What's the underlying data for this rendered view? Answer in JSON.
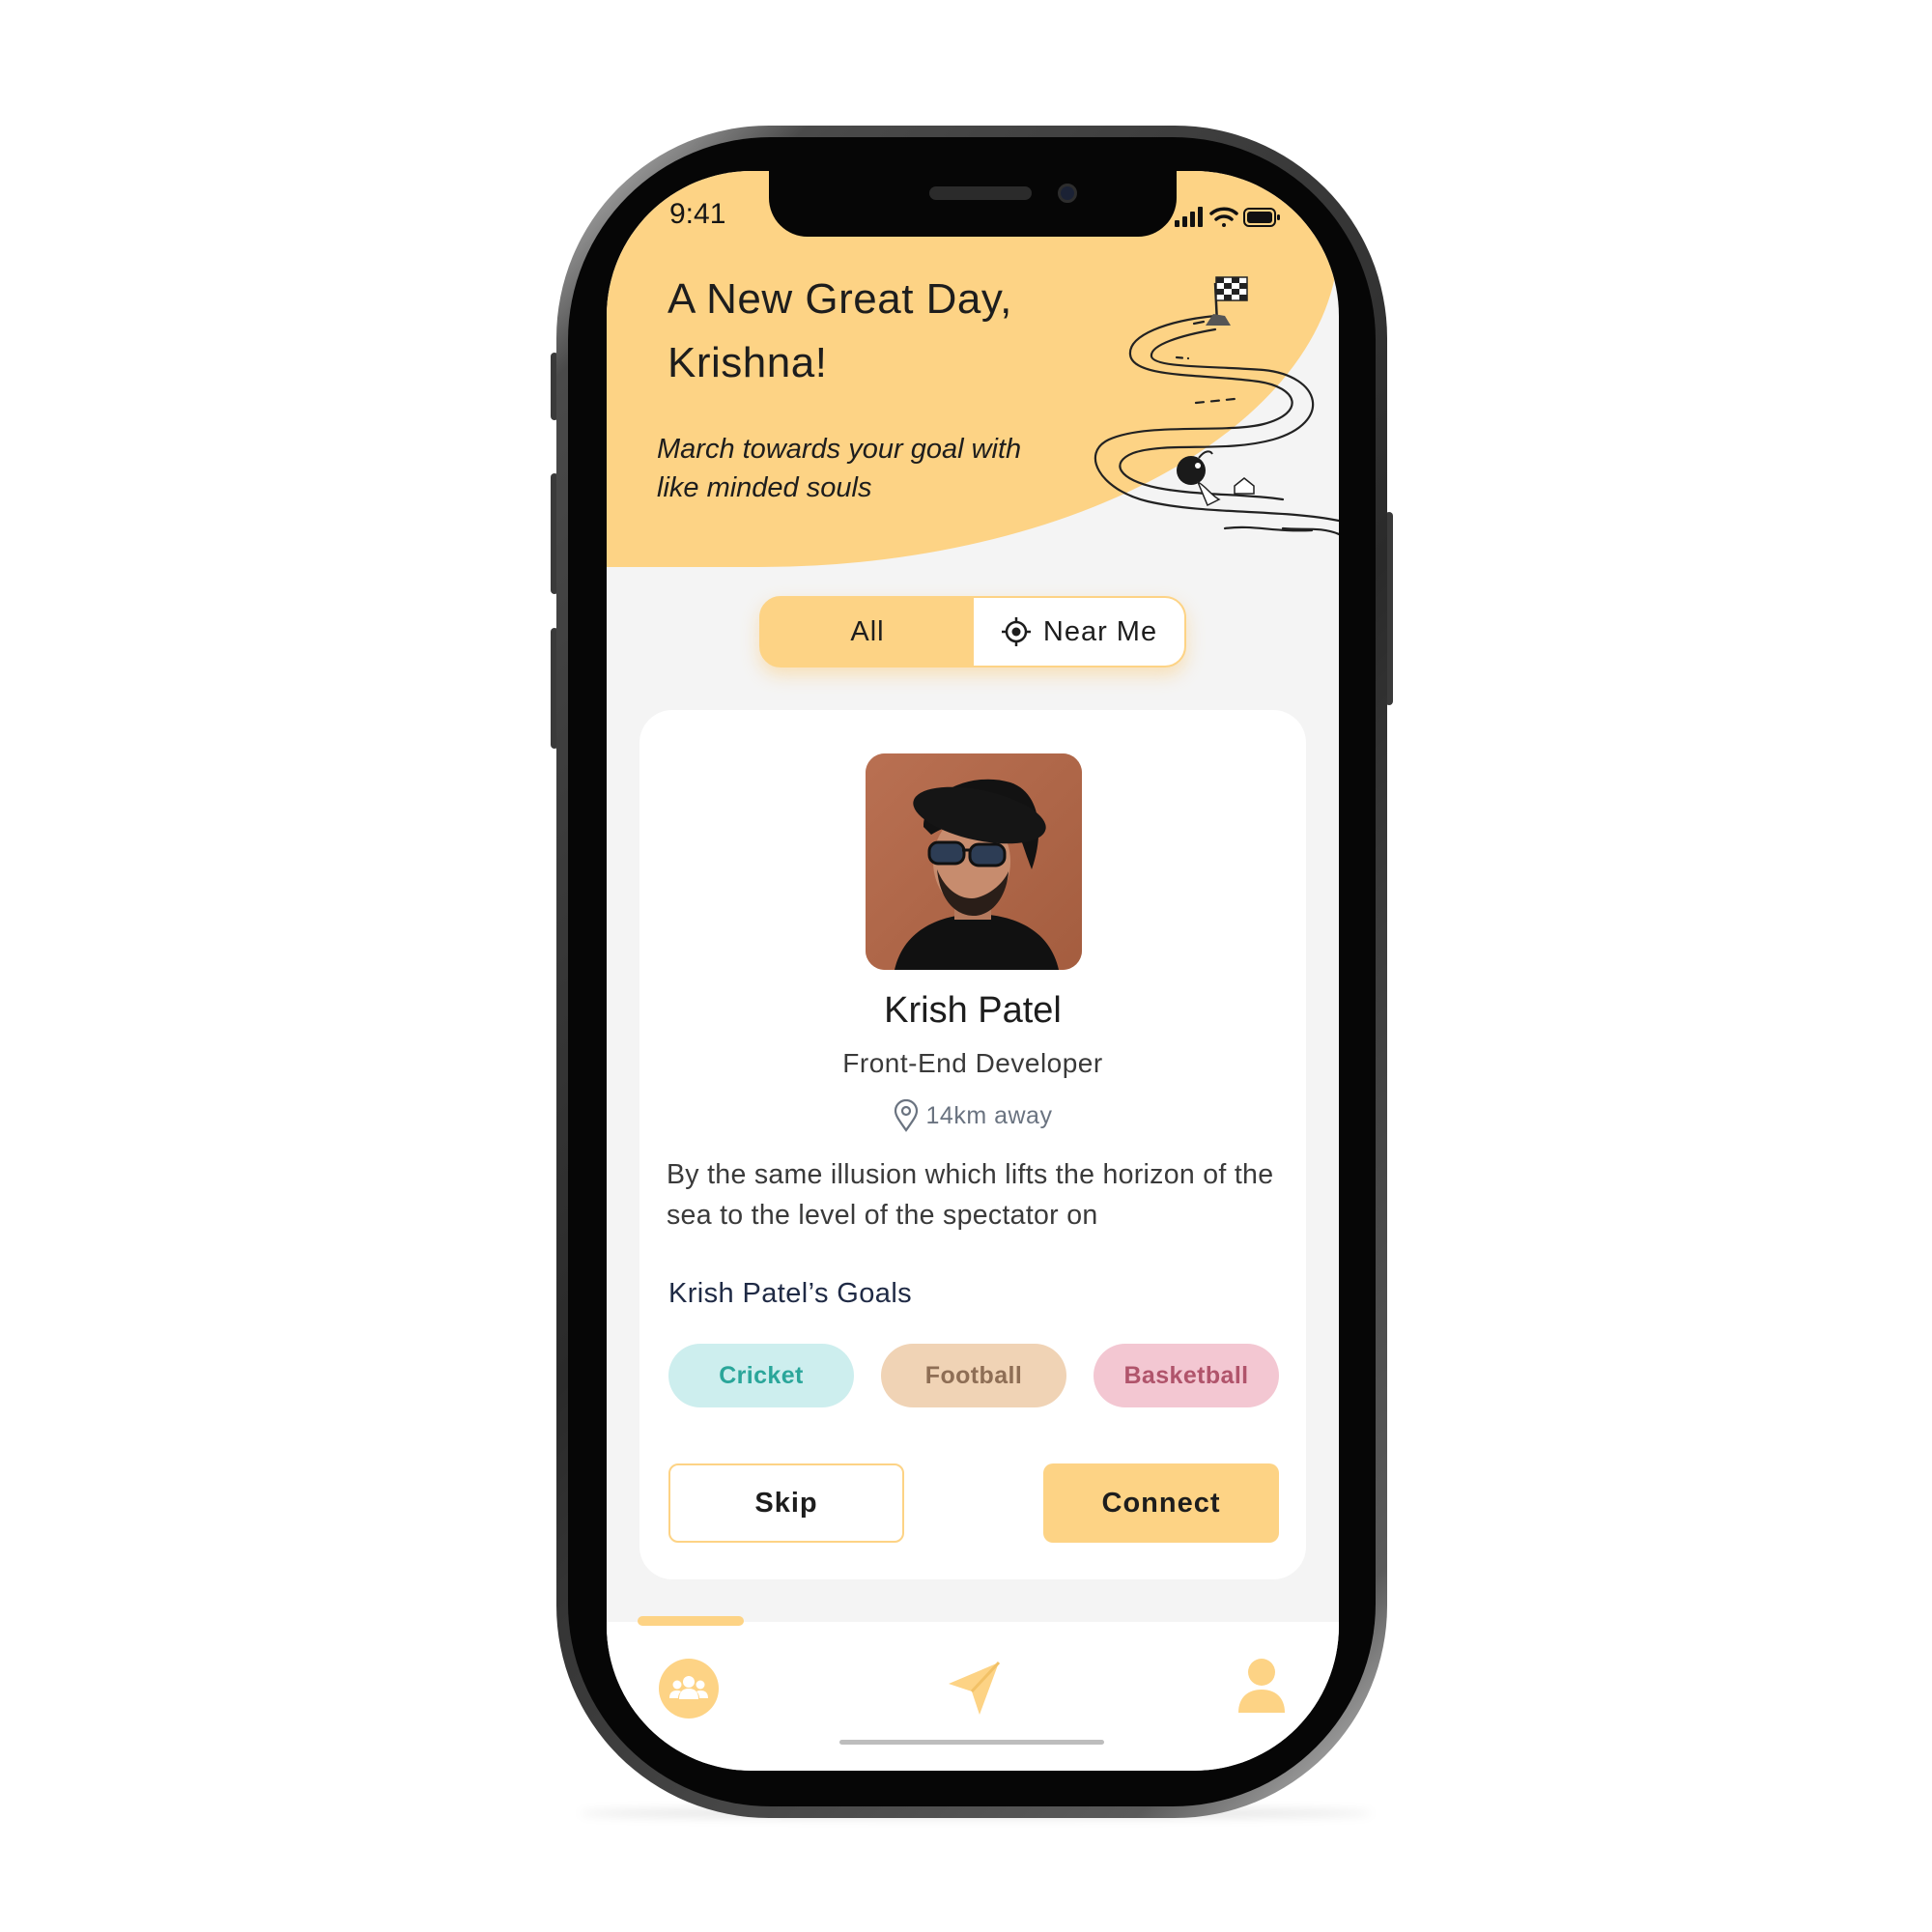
{
  "status_bar": {
    "time": "9:41"
  },
  "header": {
    "greeting": "A New Great Day, Krishna!",
    "tagline": "March towards your goal with like minded souls"
  },
  "filter": {
    "options": [
      "All",
      "Near Me"
    ],
    "selected": "All"
  },
  "profile": {
    "name": "Krish Patel",
    "role": "Front-End Developer",
    "distance": "14km away",
    "bio": "By the same illusion which lifts the horizon of the sea to the level of the spectator on",
    "goals_title": "Krish Patel’s Goals",
    "goals": [
      "Cricket",
      "Football",
      "Basketball"
    ]
  },
  "actions": {
    "skip_label": "Skip",
    "connect_label": "Connect"
  },
  "tabbar": {
    "active": "community",
    "icons": [
      "community-icon",
      "send-icon",
      "profile-icon"
    ]
  },
  "colors": {
    "accent": "#fdd385",
    "cricket_bg": "#cdeeee",
    "football_bg": "#f0d3b5",
    "basketball_bg": "#f3c7d2"
  }
}
